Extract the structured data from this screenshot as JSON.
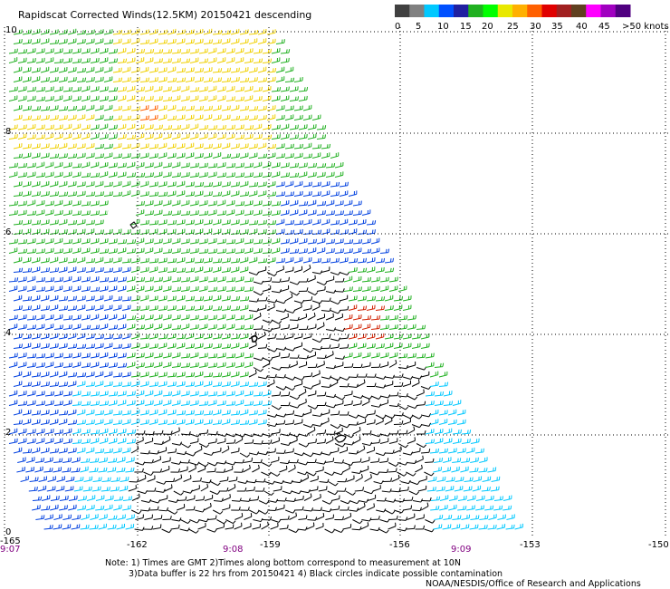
{
  "title": "Rapidscat Corrected Winds(12.5KM) 20150421 descending",
  "legend": {
    "labels": [
      "0",
      "5",
      "10",
      "15",
      "20",
      "25",
      "30",
      "35",
      "40",
      "45",
      ">50 knots"
    ],
    "colors": [
      "#404040",
      "#808080",
      "#00c8ff",
      "#0050ff",
      "#2020a0",
      "#20b020",
      "#00ff00",
      "#e8e800",
      "#ffb000",
      "#ff6000",
      "#e00000",
      "#a02020",
      "#604020",
      "#ff00ff",
      "#a000c0",
      "#500080"
    ],
    "colors_note": "color ramp drawn in the legend bar"
  },
  "axes": {
    "x_ticks": [
      "-165",
      "-162",
      "-159",
      "-156",
      "-153",
      "-150"
    ],
    "y_ticks": [
      "10",
      "8",
      "6",
      "4",
      "2",
      "0"
    ],
    "time_labels": [
      "9:07",
      "9:08",
      "9:09"
    ]
  },
  "wind_colors": {
    "calm_black": "#000000",
    "light_cyan": "#00c8ff",
    "blue": "#0040e0",
    "green": "#20b020",
    "yellow": "#f0d000",
    "orange": "#ff6000",
    "red": "#d02000"
  },
  "notes": {
    "line1": "Note: 1) Times are GMT 2)Times along bottom correspond to measurement at 10N",
    "line2": "3)Data buffer is 22 hrs from 20150421 4) Black circles indicate possible contamination",
    "credit": "NOAA/NESDIS/Office of Research and Applications"
  }
}
